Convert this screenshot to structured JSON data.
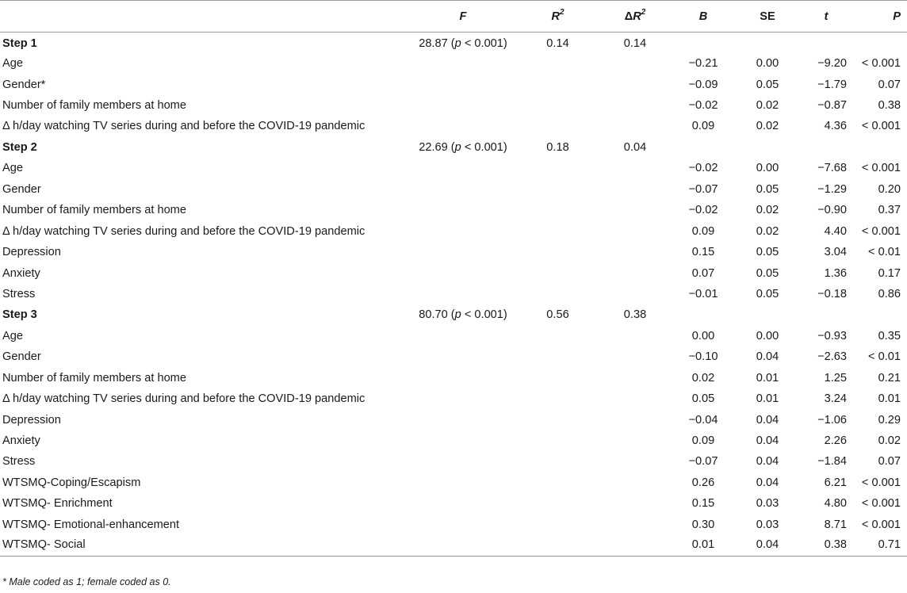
{
  "header": {
    "f": "F",
    "r2_base": "R",
    "r2_sup": "2",
    "dr2_delta": "Δ",
    "dr2_base": "R",
    "dr2_sup": "2",
    "b": "B",
    "se": "SE",
    "t": "t",
    "p": "P"
  },
  "rows": [
    {
      "type": "step",
      "label": "Step 1",
      "f_val": "28.87 (",
      "f_p": "p",
      "f_rest": " < 0.001)",
      "r2": "0.14",
      "dr2": "0.14"
    },
    {
      "type": "var",
      "label": "Age",
      "b": "−0.21",
      "se": "0.00",
      "t": "−9.20",
      "p": "< 0.001"
    },
    {
      "type": "var",
      "label": "Gender*",
      "b": "−0.09",
      "se": "0.05",
      "t": "−1.79",
      "p": "0.07"
    },
    {
      "type": "var",
      "label": "Number of family members at home",
      "b": "−0.02",
      "se": "0.02",
      "t": "−0.87",
      "p": "0.38"
    },
    {
      "type": "var",
      "label": "Δ h/day watching TV series during and before the COVID-19 pandemic",
      "b": "0.09",
      "se": "0.02",
      "t": "4.36",
      "p": "< 0.001"
    },
    {
      "type": "step",
      "label": "Step 2",
      "f_val": "22.69 (",
      "f_p": "p",
      "f_rest": " < 0.001)",
      "r2": "0.18",
      "dr2": "0.04"
    },
    {
      "type": "var",
      "label": "Age",
      "b": "−0.02",
      "se": "0.00",
      "t": "−7.68",
      "p": "< 0.001"
    },
    {
      "type": "var",
      "label": "Gender",
      "b": "−0.07",
      "se": "0.05",
      "t": "−1.29",
      "p": "0.20"
    },
    {
      "type": "var",
      "label": "Number of family members at home",
      "b": "−0.02",
      "se": "0.02",
      "t": "−0.90",
      "p": "0.37"
    },
    {
      "type": "var",
      "label": "Δ h/day watching TV series during and before the COVID-19 pandemic",
      "b": "0.09",
      "se": "0.02",
      "t": "4.40",
      "p": "< 0.001"
    },
    {
      "type": "var",
      "label": "Depression",
      "b": "0.15",
      "se": "0.05",
      "t": "3.04",
      "p": "< 0.01"
    },
    {
      "type": "var",
      "label": "Anxiety",
      "b": "0.07",
      "se": "0.05",
      "t": "1.36",
      "p": "0.17"
    },
    {
      "type": "var",
      "label": "Stress",
      "b": "−0.01",
      "se": "0.05",
      "t": "−0.18",
      "p": "0.86"
    },
    {
      "type": "step",
      "label": "Step 3",
      "f_val": "80.70 (",
      "f_p": "p",
      "f_rest": " < 0.001)",
      "r2": "0.56",
      "dr2": "0.38"
    },
    {
      "type": "var",
      "label": "Age",
      "b": "0.00",
      "se": "0.00",
      "t": "−0.93",
      "p": "0.35"
    },
    {
      "type": "var",
      "label": "Gender",
      "b": "−0.10",
      "se": "0.04",
      "t": "−2.63",
      "p": "< 0.01"
    },
    {
      "type": "var",
      "label": "Number of family members at home",
      "b": "0.02",
      "se": "0.01",
      "t": "1.25",
      "p": "0.21"
    },
    {
      "type": "var",
      "label": "Δ h/day watching TV series during and before the COVID-19 pandemic",
      "b": "0.05",
      "se": "0.01",
      "t": "3.24",
      "p": "0.01"
    },
    {
      "type": "var",
      "label": "Depression",
      "b": "−0.04",
      "se": "0.04",
      "t": "−1.06",
      "p": "0.29"
    },
    {
      "type": "var",
      "label": "Anxiety",
      "b": "0.09",
      "se": "0.04",
      "t": "2.26",
      "p": "0.02"
    },
    {
      "type": "var",
      "label": "Stress",
      "b": "−0.07",
      "se": "0.04",
      "t": "−1.84",
      "p": "0.07"
    },
    {
      "type": "var",
      "label": "WTSMQ-Coping/Escapism",
      "b": "0.26",
      "se": "0.04",
      "t": "6.21",
      "p": "< 0.001"
    },
    {
      "type": "var",
      "label": "WTSMQ- Enrichment",
      "b": "0.15",
      "se": "0.03",
      "t": "4.80",
      "p": "< 0.001"
    },
    {
      "type": "var",
      "label": "WTSMQ- Emotional-enhancement",
      "b": "0.30",
      "se": "0.03",
      "t": "8.71",
      "p": "< 0.001"
    },
    {
      "type": "var",
      "label": "WTSMQ- Social",
      "b": "0.01",
      "se": "0.04",
      "t": "0.38",
      "p": "0.71"
    }
  ],
  "footnote": "* Male coded as 1; female coded as 0."
}
